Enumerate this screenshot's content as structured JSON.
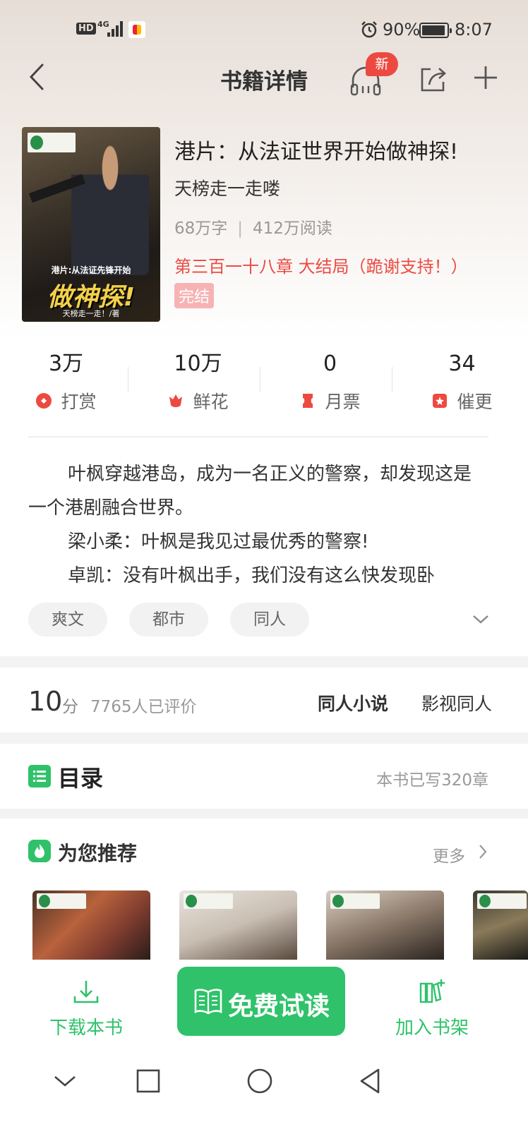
{
  "status_bar": {
    "hd": "HD",
    "network": "4G",
    "battery_percent": "90%",
    "time": "8:07"
  },
  "header": {
    "title": "书籍详情",
    "new_badge": "新"
  },
  "book": {
    "title": "港片：从法证世界开始做神探!",
    "author": "天榜走一走喽",
    "word_count": "68万字",
    "reads": "412万阅读",
    "stats_separator": "|",
    "latest_chapter": "第三百一十八章 大结局（跪谢支持！）",
    "status": "完结",
    "cover": {
      "subtitle": "港片:从法证先锋开始",
      "title": "做神探!",
      "author_line": "天榜走一走！/著"
    }
  },
  "counters": [
    {
      "value": "3万",
      "label": "打赏",
      "icon": "reward-icon"
    },
    {
      "value": "10万",
      "label": "鲜花",
      "icon": "flower-icon"
    },
    {
      "value": "0",
      "label": "月票",
      "icon": "ticket-icon"
    },
    {
      "value": "34",
      "label": "催更",
      "icon": "urge-icon"
    }
  ],
  "synopsis": [
    "叶枫穿越港岛，成为一名正义的警察，却发现这是一个港剧融合世界。",
    "梁小柔：叶枫是我见过最优秀的警察!",
    "卓凯：没有叶枫出手，我们没有这么快发现卧"
  ],
  "tags": [
    "爽文",
    "都市",
    "同人"
  ],
  "rating": {
    "score": "10",
    "unit": "分",
    "count": "7765人已评价",
    "genre_primary": "同人小说",
    "genre_secondary": "影视同人"
  },
  "toc": {
    "title": "目录",
    "chapter_count": "本书已写320章"
  },
  "recommend": {
    "title": "为您推荐",
    "more": "更多"
  },
  "actions": {
    "download": "下载本书",
    "read": "免费试读",
    "add_shelf": "加入书架"
  },
  "colors": {
    "accent": "#2fc26a",
    "alert_red": "#ec4a41"
  }
}
